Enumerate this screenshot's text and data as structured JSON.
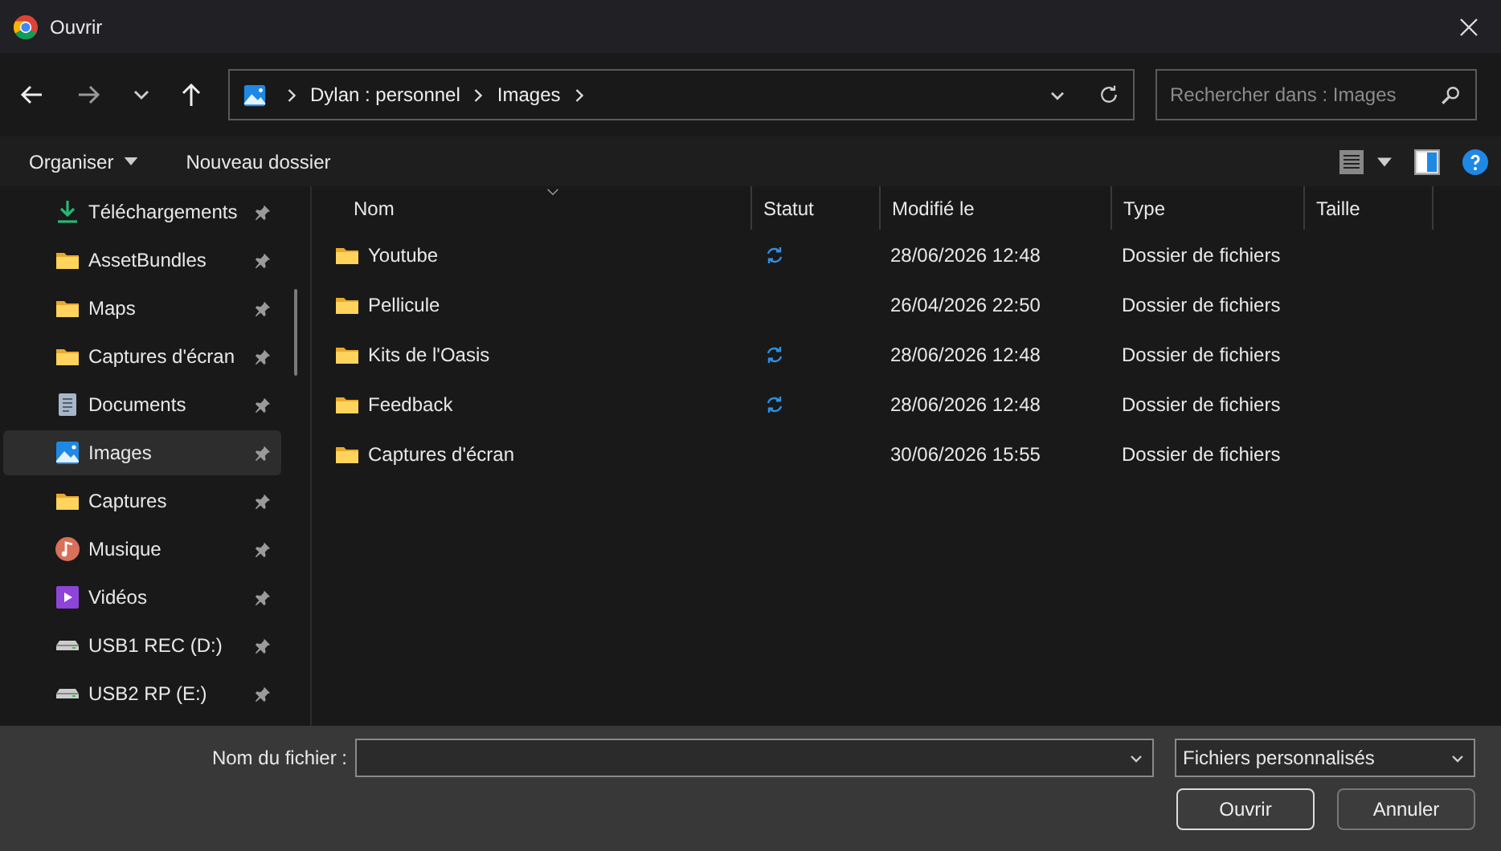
{
  "window": {
    "title": "Ouvrir"
  },
  "address": {
    "segments": [
      "Dylan : personnel",
      "Images"
    ]
  },
  "search": {
    "placeholder": "Rechercher dans : Images"
  },
  "commands": [
    {
      "label": "Organiser",
      "dropdown": true
    },
    {
      "label": "Nouveau dossier",
      "dropdown": false
    }
  ],
  "sidebar": {
    "items": [
      {
        "label": "Téléchargements",
        "kind": "download",
        "selected": false,
        "pinned": true
      },
      {
        "label": "AssetBundles",
        "kind": "folder",
        "selected": false,
        "pinned": true
      },
      {
        "label": "Maps",
        "kind": "folder",
        "selected": false,
        "pinned": true
      },
      {
        "label": "Captures d'écran",
        "kind": "folder",
        "selected": false,
        "pinned": true
      },
      {
        "label": "Documents",
        "kind": "document",
        "selected": false,
        "pinned": true
      },
      {
        "label": "Images",
        "kind": "pictures",
        "selected": true,
        "pinned": true
      },
      {
        "label": "Captures",
        "kind": "folder",
        "selected": false,
        "pinned": true
      },
      {
        "label": "Musique",
        "kind": "music",
        "selected": false,
        "pinned": true
      },
      {
        "label": "Vidéos",
        "kind": "video",
        "selected": false,
        "pinned": true
      },
      {
        "label": "USB1 REC (D:)",
        "kind": "drive",
        "selected": false,
        "pinned": true
      },
      {
        "label": "USB2 RP (E:)",
        "kind": "drive",
        "selected": false,
        "pinned": true
      }
    ]
  },
  "table": {
    "columns": [
      "Nom",
      "Statut",
      "Modifié le",
      "Type",
      "Taille"
    ],
    "rows": [
      {
        "name": "Youtube",
        "synced": true,
        "modified": "28/06/2026 12:48",
        "type": "Dossier de fichiers"
      },
      {
        "name": "Pellicule",
        "synced": false,
        "modified": "26/04/2026 22:50",
        "type": "Dossier de fichiers"
      },
      {
        "name": "Kits de l'Oasis",
        "synced": true,
        "modified": "28/06/2026 12:48",
        "type": "Dossier de fichiers"
      },
      {
        "name": "Feedback",
        "synced": true,
        "modified": "28/06/2026 12:48",
        "type": "Dossier de fichiers"
      },
      {
        "name": "Captures d'écran",
        "synced": false,
        "modified": "30/06/2026 15:55",
        "type": "Dossier de fichiers"
      }
    ]
  },
  "footer": {
    "filename_label": "Nom du fichier :",
    "filetype": "Fichiers personnalisés",
    "buttons": [
      {
        "label": "Ouvrir",
        "default": true
      },
      {
        "label": "Annuler",
        "default": false
      }
    ]
  }
}
